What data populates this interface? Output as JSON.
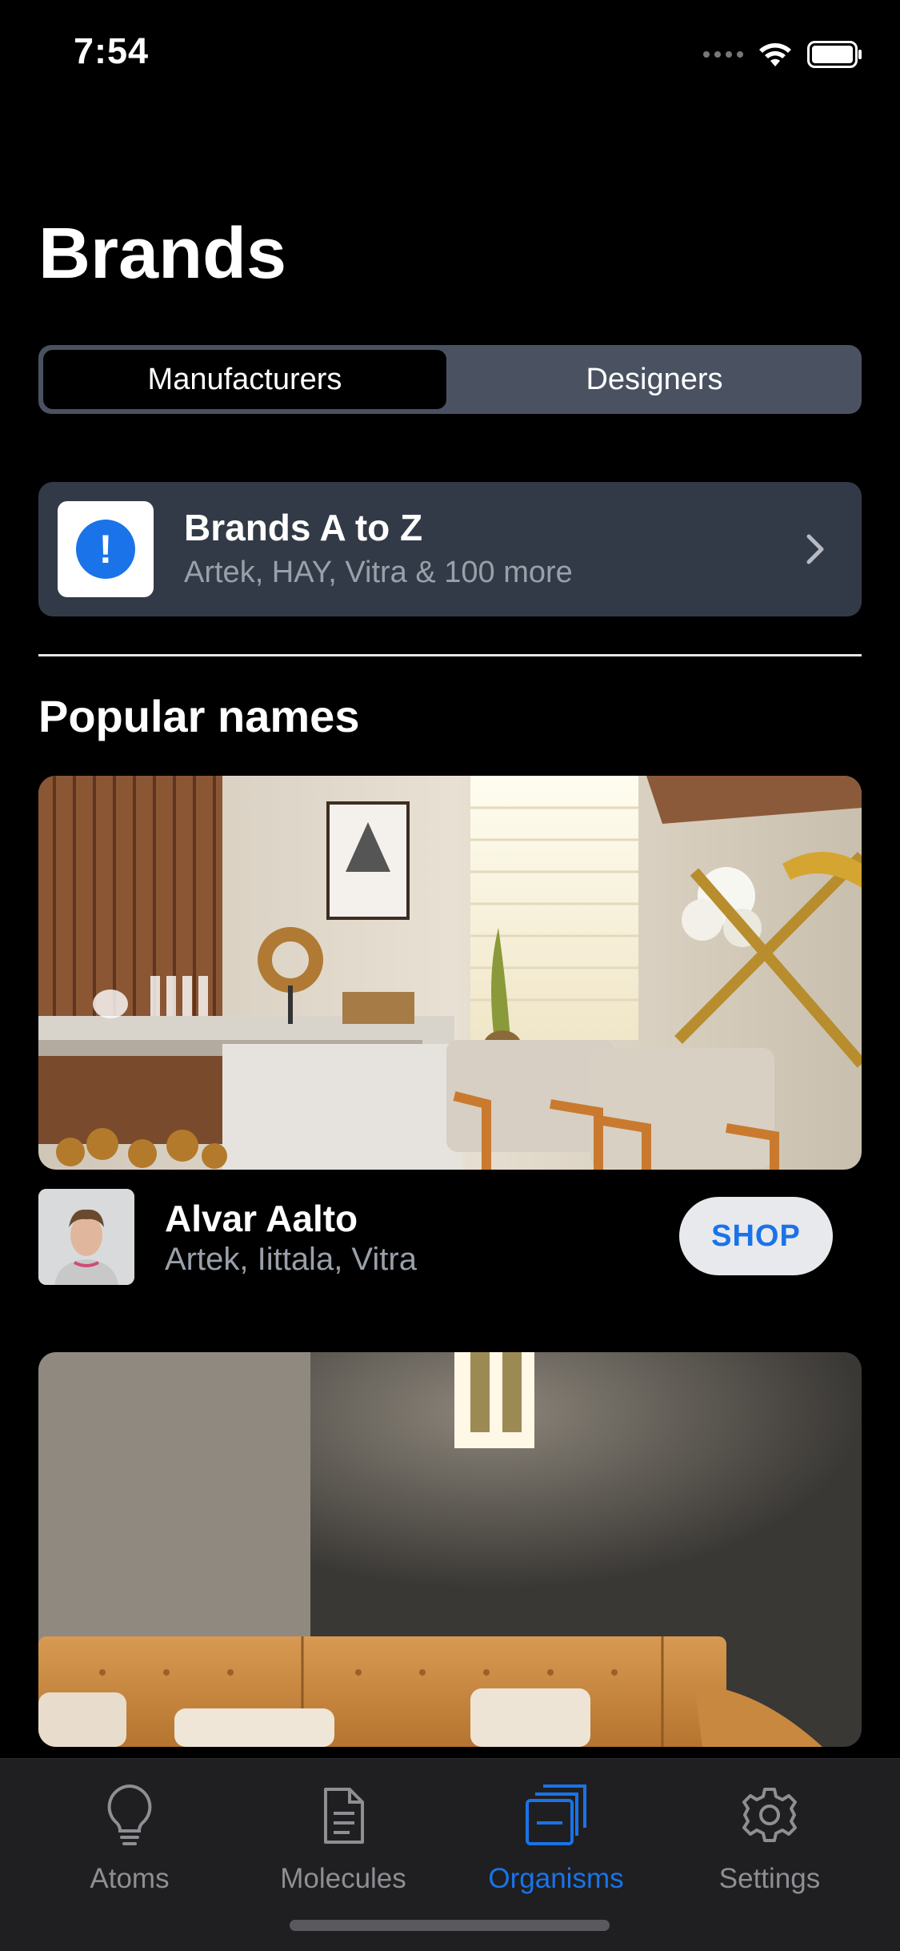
{
  "status_bar": {
    "time": "7:54"
  },
  "header": {
    "title": "Brands"
  },
  "segmented_control": {
    "options": [
      "Manufacturers",
      "Designers"
    ],
    "selected": "Manufacturers"
  },
  "brands_az": {
    "title": "Brands A to Z",
    "subtitle": "Artek, HAY, Vitra & 100 more"
  },
  "popular": {
    "title": "Popular names",
    "items": [
      {
        "name": "Alvar Aalto",
        "brands": "Artek, Iittala, Vitra",
        "button": "SHOP"
      }
    ]
  },
  "tab_bar": {
    "items": [
      {
        "label": "Atoms",
        "icon": "lightbulb-icon"
      },
      {
        "label": "Molecules",
        "icon": "document-icon"
      },
      {
        "label": "Organisms",
        "icon": "stacked-windows-icon"
      },
      {
        "label": "Settings",
        "icon": "gear-icon"
      }
    ],
    "selected": "Organisms"
  },
  "colors": {
    "accent": "#1a73e8",
    "card": "#333a47",
    "segment_bg": "#4a5262",
    "tab_inactive": "#8e8e93"
  }
}
